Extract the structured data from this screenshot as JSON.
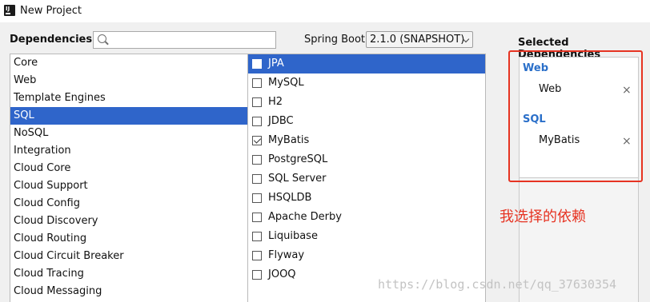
{
  "window": {
    "title": "New Project"
  },
  "header": {
    "dependencies_label": "Dependencies",
    "search": {
      "value": "",
      "placeholder": ""
    },
    "spring_boot_label": "Spring Boot",
    "spring_boot_version": "2.1.0 (SNAPSHOT)",
    "selected_heading": "Selected Dependencies"
  },
  "categories": [
    {
      "label": "Core",
      "selected": false
    },
    {
      "label": "Web",
      "selected": false
    },
    {
      "label": "Template Engines",
      "selected": false
    },
    {
      "label": "SQL",
      "selected": true
    },
    {
      "label": "NoSQL",
      "selected": false
    },
    {
      "label": "Integration",
      "selected": false
    },
    {
      "label": "Cloud Core",
      "selected": false
    },
    {
      "label": "Cloud Support",
      "selected": false
    },
    {
      "label": "Cloud Config",
      "selected": false
    },
    {
      "label": "Cloud Discovery",
      "selected": false
    },
    {
      "label": "Cloud Routing",
      "selected": false
    },
    {
      "label": "Cloud Circuit Breaker",
      "selected": false
    },
    {
      "label": "Cloud Tracing",
      "selected": false
    },
    {
      "label": "Cloud Messaging",
      "selected": false
    }
  ],
  "dependencies": [
    {
      "label": "JPA",
      "checked": false,
      "highlighted": true
    },
    {
      "label": "MySQL",
      "checked": false,
      "highlighted": false
    },
    {
      "label": "H2",
      "checked": false,
      "highlighted": false
    },
    {
      "label": "JDBC",
      "checked": false,
      "highlighted": false
    },
    {
      "label": "MyBatis",
      "checked": true,
      "highlighted": false
    },
    {
      "label": "PostgreSQL",
      "checked": false,
      "highlighted": false
    },
    {
      "label": "SQL Server",
      "checked": false,
      "highlighted": false
    },
    {
      "label": "HSQLDB",
      "checked": false,
      "highlighted": false
    },
    {
      "label": "Apache Derby",
      "checked": false,
      "highlighted": false
    },
    {
      "label": "Liquibase",
      "checked": false,
      "highlighted": false
    },
    {
      "label": "Flyway",
      "checked": false,
      "highlighted": false
    },
    {
      "label": "JOOQ",
      "checked": false,
      "highlighted": false
    }
  ],
  "selected": {
    "groups": [
      {
        "title": "Web",
        "items": [
          {
            "label": "Web",
            "remove_icon": "close-icon",
            "remove_glyph": "×"
          }
        ]
      },
      {
        "title": "SQL",
        "items": [
          {
            "label": "MyBatis",
            "remove_icon": "close-icon",
            "remove_glyph": "×"
          }
        ]
      }
    ]
  },
  "annotation": "我选择的依赖",
  "watermark": "https://blog.csdn.net/qq_37630354",
  "colors": {
    "selection": "#2f65ca",
    "group_title": "#2a6fc9",
    "annotation_red": "#e63322"
  }
}
